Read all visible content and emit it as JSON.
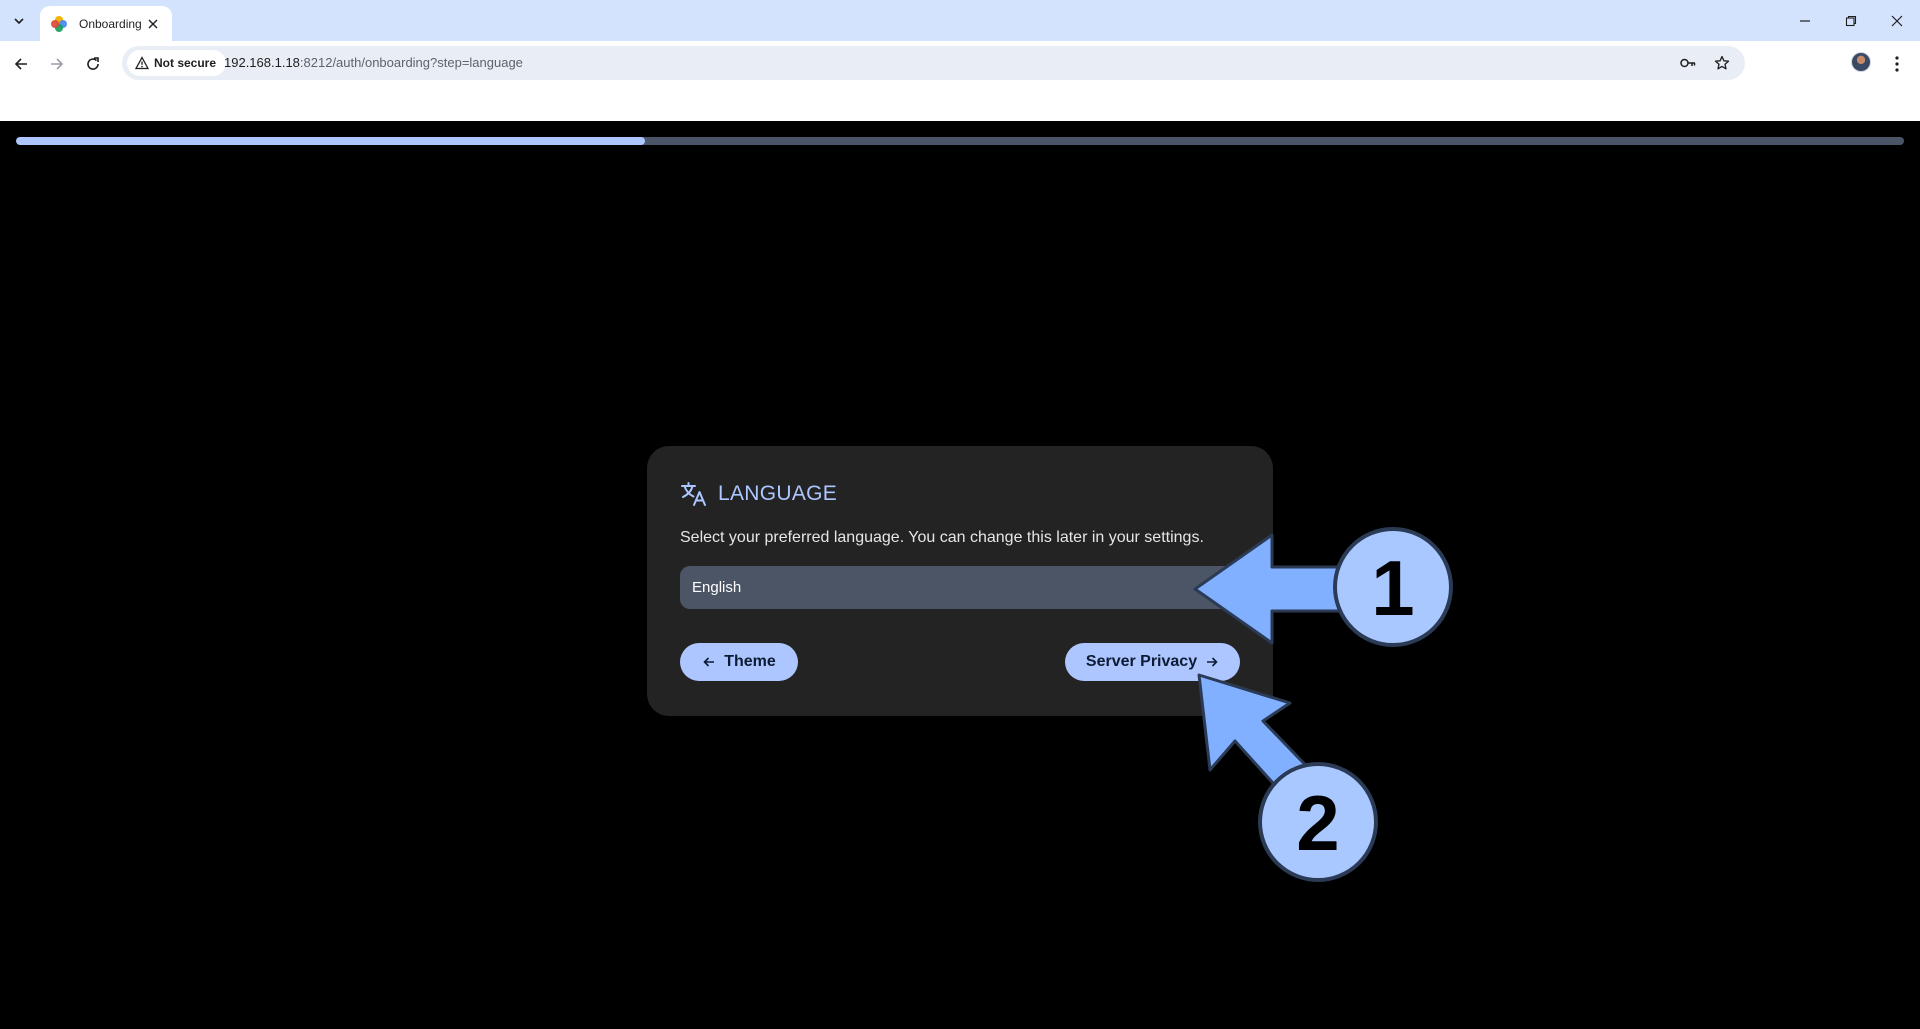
{
  "browser": {
    "tab_title": "Onboarding",
    "security_label": "Not secure",
    "url_host": "192.168.1.18",
    "url_rest": ":8212/auth/onboarding?step=language"
  },
  "onboarding": {
    "progress_fraction": 0.333,
    "card": {
      "title": "LANGUAGE",
      "description": "Select your preferred language. You can change this later in your settings.",
      "selected_language": "English",
      "prev_button": "Theme",
      "next_button": "Server Privacy"
    }
  },
  "annotations": {
    "step1": "1",
    "step2": "2",
    "arrow_color": "#80b0ff",
    "badge_color": "#a8c8ff"
  },
  "colors": {
    "accent": "#adc6ff",
    "card_bg": "#232323",
    "select_bg": "#4b5565",
    "page_bg": "#000000"
  }
}
